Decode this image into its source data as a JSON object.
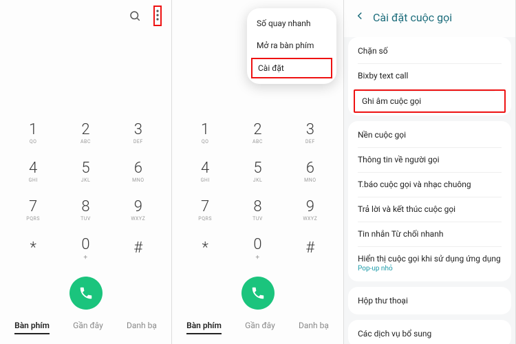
{
  "keypad": {
    "rows": [
      [
        {
          "d": "1",
          "s": "QO"
        },
        {
          "d": "2",
          "s": "ABC"
        },
        {
          "d": "3",
          "s": "DEF"
        }
      ],
      [
        {
          "d": "4",
          "s": "GHI"
        },
        {
          "d": "5",
          "s": "JKL"
        },
        {
          "d": "6",
          "s": "MNO"
        }
      ],
      [
        {
          "d": "7",
          "s": "PQRS"
        },
        {
          "d": "8",
          "s": "TUV"
        },
        {
          "d": "9",
          "s": "WXYZ"
        }
      ],
      [
        {
          "d": "*",
          "s": ""
        },
        {
          "d": "0",
          "s": "+"
        },
        {
          "d": "#",
          "s": ""
        }
      ]
    ]
  },
  "tabs": {
    "keypad": "Bàn phím",
    "recent": "Gần đây",
    "contacts": "Danh bạ"
  },
  "popup": {
    "speedDial": "Số quay nhanh",
    "openKeypad": "Mở ra bàn phím",
    "settings": "Cài đặt"
  },
  "settings": {
    "title": "Cài đặt cuộc gọi",
    "group1": {
      "blockNumber": "Chặn số",
      "bixby": "Bixby text call",
      "record": "Ghi âm cuộc gọi"
    },
    "group2": {
      "background": "Nền cuộc gọi",
      "callerInfo": "Thông tin về người gọi",
      "notify": "T.báo cuộc gọi và nhạc chuông",
      "answer": "Trả lời và kết thúc cuộc gọi",
      "quickDecline": "Tin nhắn Từ chối nhanh",
      "showInApp": "Hiển thị cuộc gọi khi sử dụng ứng dụng",
      "showInAppSub": "Pop-up nhỏ"
    },
    "group3": {
      "voicemail": "Hộp thư thoại"
    },
    "group4": {
      "extra": "Các dịch vụ bổ sung"
    }
  }
}
